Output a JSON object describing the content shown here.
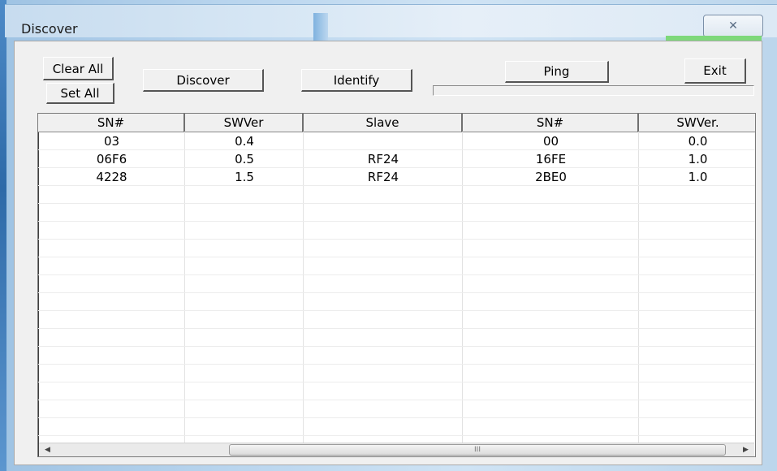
{
  "window": {
    "title": "Discover",
    "close_glyph": "✕"
  },
  "buttons": {
    "clear_all": "Clear All",
    "set_all": "Set All",
    "discover": "Discover",
    "identify": "Identify",
    "ping": "Ping",
    "exit": "Exit"
  },
  "progress": {
    "value": 0
  },
  "table": {
    "columns": [
      "SN#",
      "SWVer",
      "Slave",
      "SN#",
      "SWVer."
    ],
    "rows": [
      [
        "03",
        "0.4",
        "",
        "00",
        "0.0"
      ],
      [
        "06F6",
        "0.5",
        "RF24",
        "16FE",
        "1.0"
      ],
      [
        "4228",
        "1.5",
        "RF24",
        "2BE0",
        "1.0"
      ]
    ]
  },
  "scrollbar": {
    "left_arrow": "◀",
    "right_arrow": "▶",
    "grip": "III"
  }
}
